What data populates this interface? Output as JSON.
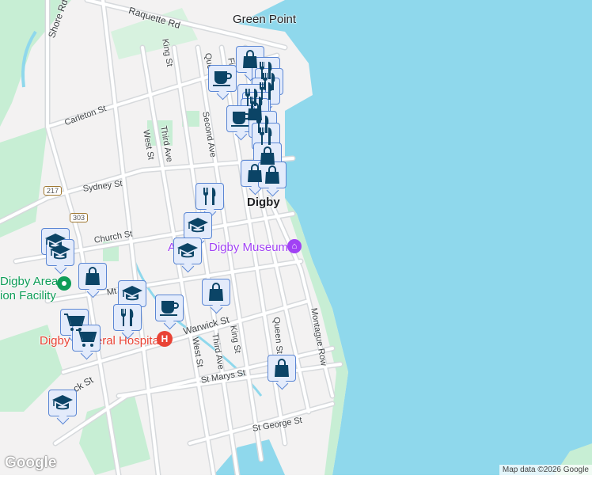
{
  "map": {
    "colors": {
      "water": "#8fd8ec",
      "land": "#f3f2f2",
      "park": "#c7eed4",
      "road": "#ffffff",
      "marker_fill": "#e3ebfb",
      "marker_border": "#5a86d4",
      "icon": "#0b4466",
      "museum": "#a142f4",
      "hospital": "#e94335",
      "facility": "#0f9d58"
    },
    "places": {
      "green_point": "Green Point",
      "digby": "Digby",
      "museum": "Digby Museum",
      "museum_prefix": "A",
      "facility_line1": "Digby Area",
      "facility_line2": "ion Facility",
      "hospital": "Digby General Hospital"
    },
    "streets": {
      "raquette": "Raquette Rd",
      "shore": "Shore Rd",
      "king_n": "King St",
      "queen_n": "Que",
      "first": "Fir",
      "carleton": "Carleton St",
      "third_n": "Third Ave",
      "west_n": "West St",
      "second": "Second Ave",
      "sydney": "Sydney St",
      "church": "Church St",
      "mt": "Mt",
      "warwick": "Warwick St",
      "west_s": "West St",
      "third_s": "Third Ave",
      "king_s": "King St",
      "queen_s": "Queen St",
      "montague": "Montague Row",
      "st_marys": "St Marys St",
      "st_george": "St George St",
      "hwy217": "217",
      "hwy303": "303",
      "ck": "ck St"
    },
    "markers": [
      "shopping",
      "restaurant",
      "restaurant",
      "restaurant",
      "cafe",
      "restaurant",
      "restaurant",
      "shopping",
      "cafe",
      "restaurant",
      "restaurant",
      "shopping",
      "shopping",
      "shopping",
      "restaurant",
      "education",
      "education",
      "education",
      "education",
      "shopping",
      "education",
      "restaurant",
      "cafe",
      "shopping",
      "shopping",
      "shopping-cart",
      "shopping-cart",
      "education"
    ],
    "attribution": "Map data ©2026 Google",
    "logo": "Google"
  }
}
